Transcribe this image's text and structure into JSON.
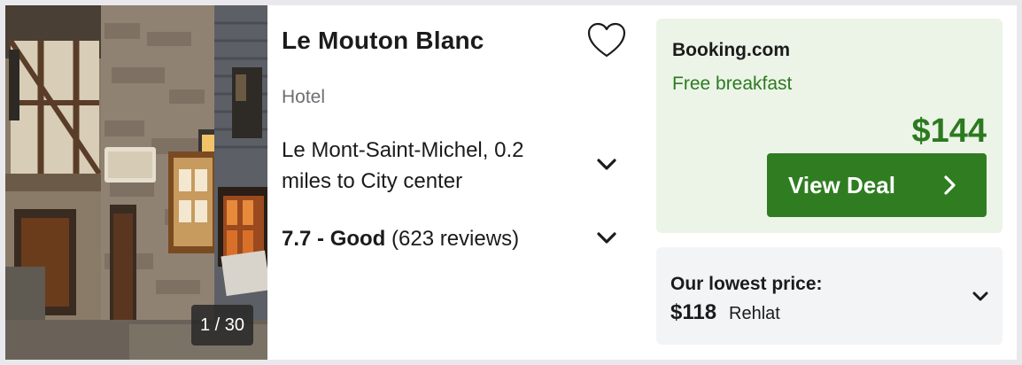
{
  "hotel": {
    "name": "Le Mouton Blanc",
    "type": "Hotel",
    "location": "Le Mont-Saint-Michel, 0.2 miles to City center",
    "rating_score": "7.7 - Good",
    "rating_reviews": "(623 reviews)"
  },
  "gallery": {
    "counter": "1 / 30"
  },
  "deal": {
    "provider": "Booking.com",
    "perk": "Free breakfast",
    "price": "$144",
    "button_label": "View Deal"
  },
  "lowest": {
    "label": "Our lowest price:",
    "price": "$118",
    "site": "Rehlat"
  },
  "colors": {
    "accent_green": "#2f7d20",
    "deal_bg": "#ecf4e8",
    "perk_text": "#2c7a1e"
  },
  "icons": {
    "favorite": "heart-outline-icon",
    "expand": "chevron-down-icon",
    "next": "chevron-right-icon"
  }
}
